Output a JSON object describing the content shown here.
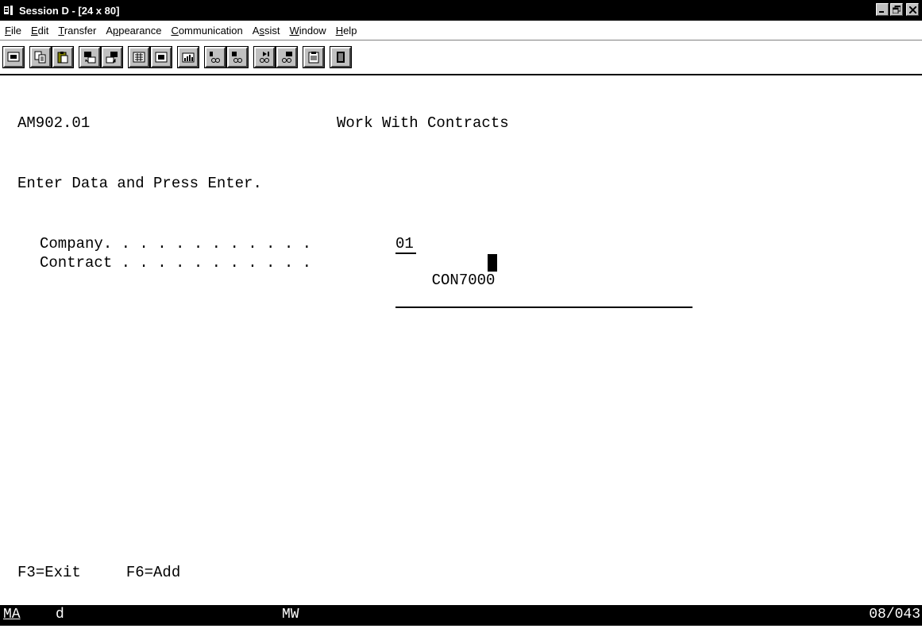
{
  "window": {
    "title": "Session D - [24 x 80]",
    "controls": {
      "minimize": "_",
      "maximize": "Θ",
      "close": "×"
    }
  },
  "menu": {
    "items": [
      {
        "label": "File",
        "accel": "F"
      },
      {
        "label": "Edit",
        "accel": "E"
      },
      {
        "label": "Transfer",
        "accel": "T"
      },
      {
        "label": "Appearance",
        "accel": "p"
      },
      {
        "label": "Communication",
        "accel": "C"
      },
      {
        "label": "Assist",
        "accel": "s"
      },
      {
        "label": "Window",
        "accel": "W"
      },
      {
        "label": "Help",
        "accel": "H"
      }
    ]
  },
  "toolbar": {
    "buttons": [
      "print-screen-icon",
      "copy-icon",
      "paste-icon",
      "send-file-icon",
      "receive-file-icon",
      "keypad-icon",
      "display-icon",
      "chart-icon",
      "macro-record-icon",
      "macro-stop-icon",
      "macro-play-icon",
      "macro-edit-icon",
      "clipboard-icon",
      "exit-icon"
    ]
  },
  "screen": {
    "program_id": "AM902.01",
    "title": "Work With Contracts",
    "instruction": "Enter Data and Press Enter.",
    "fields": [
      {
        "label": "Company. . . . . . . . . . . .",
        "value": "01"
      },
      {
        "label": "Contract . . . . . . . . . . .",
        "value": "CON7000"
      }
    ],
    "function_keys": "F3=Exit     F6=Add"
  },
  "status": {
    "mode": "MA",
    "indicator": "d",
    "session": "MW",
    "cursor_position": "08/043"
  }
}
